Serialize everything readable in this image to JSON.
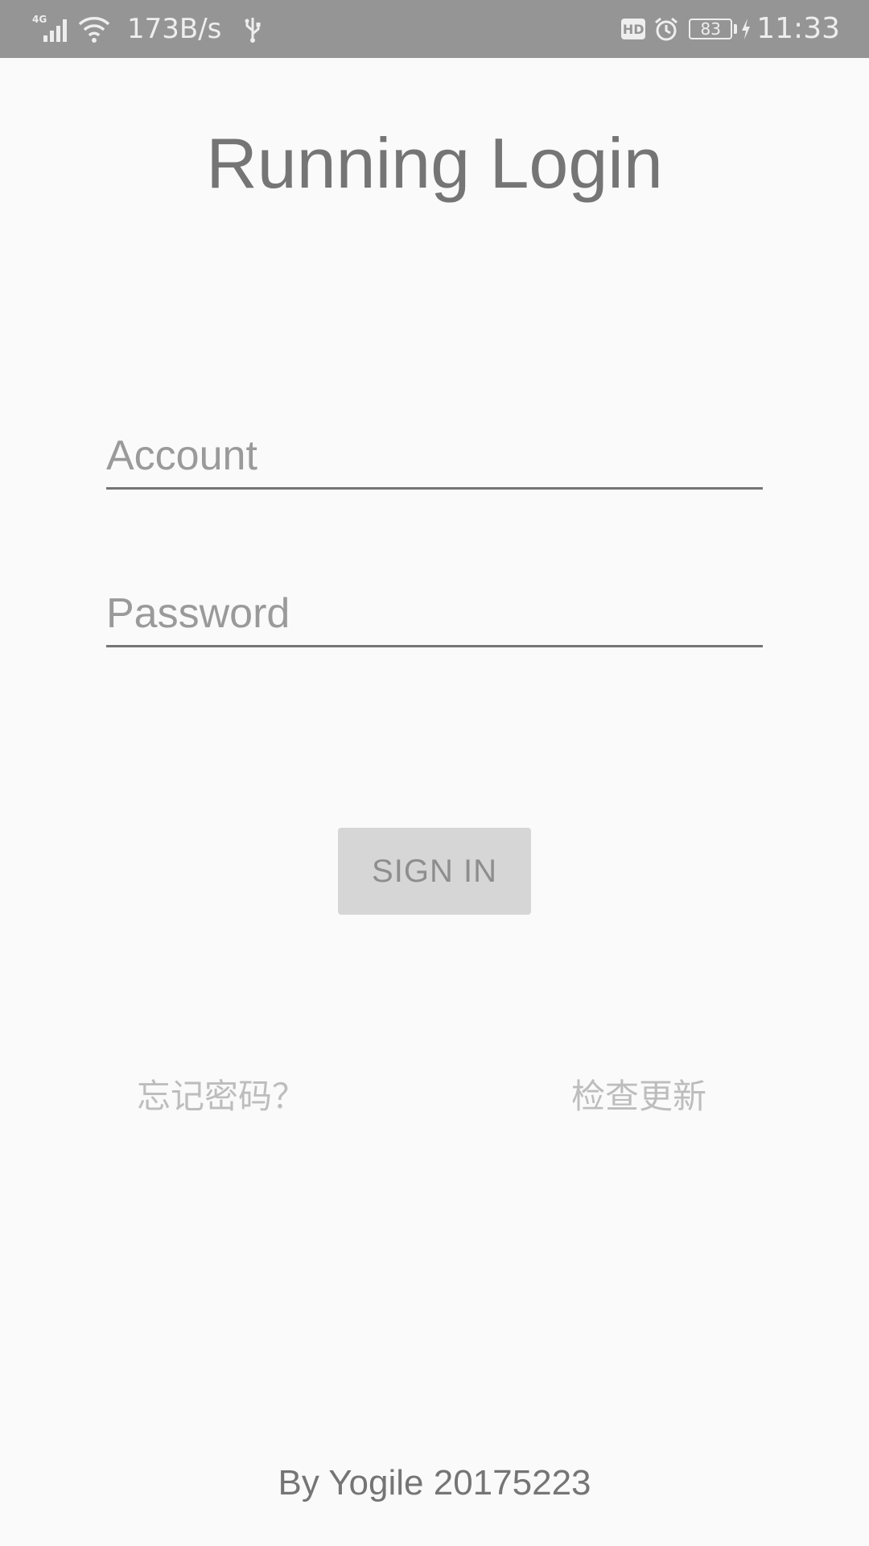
{
  "status_bar": {
    "network_type": "4G",
    "net_speed": "173B/s",
    "battery_level": "83",
    "time": "11:33",
    "icons": [
      "signal-icon",
      "wifi-icon",
      "usb-icon",
      "hd-icon",
      "alarm-icon",
      "battery-icon",
      "charging-icon"
    ],
    "background_color": "#959595"
  },
  "login": {
    "title": "Running Login",
    "account_placeholder": "Account",
    "password_placeholder": "Password",
    "sign_in_label": "SIGN IN",
    "forgot_password_label": "忘记密码？",
    "check_update_label": "检查更新"
  },
  "footer": {
    "text": "By Yogile 20175223"
  },
  "colors": {
    "background": "#fafafa",
    "title_text": "#757575",
    "button_bg": "#d6d6d6",
    "button_text": "#8e8e8e",
    "link_text": "#bdbdbd",
    "underline": "#757575"
  }
}
